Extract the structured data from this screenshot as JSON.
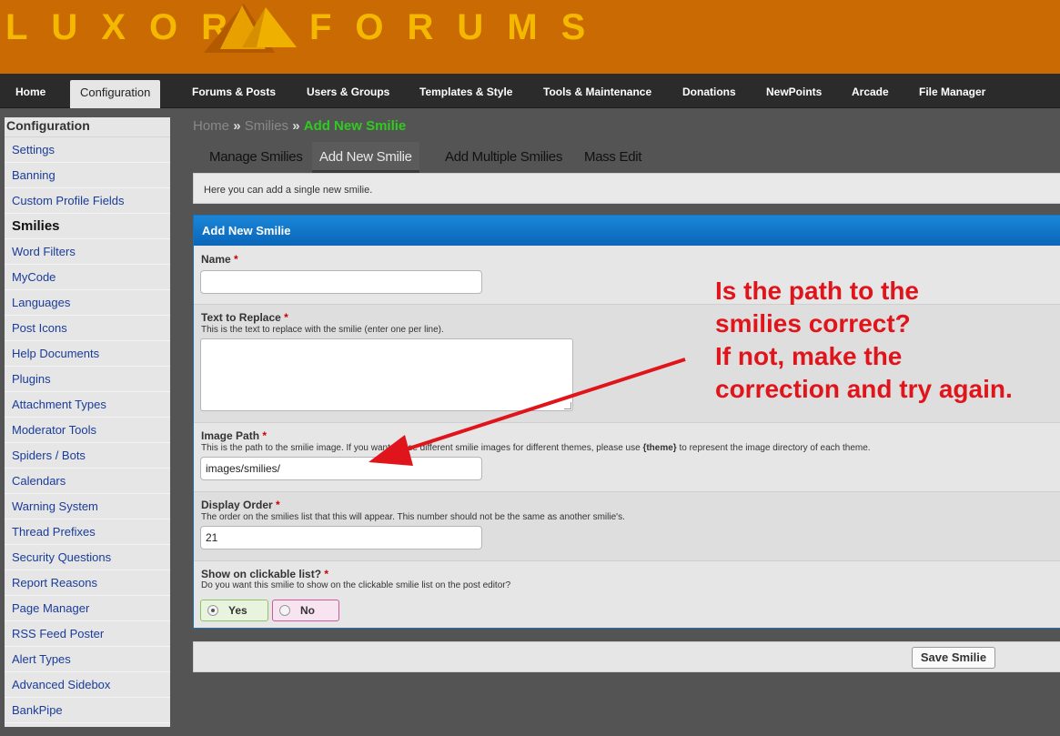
{
  "header": {
    "logo_left": "LUXOR",
    "logo_right": "FORUMS",
    "logo_icon": "pyramid-logo-icon"
  },
  "topnav": {
    "tabs": [
      {
        "label": "Home"
      },
      {
        "label": "Configuration",
        "active": true
      },
      {
        "label": "Forums & Posts"
      },
      {
        "label": "Users & Groups"
      },
      {
        "label": "Templates & Style"
      },
      {
        "label": "Tools & Maintenance"
      },
      {
        "label": "Donations"
      },
      {
        "label": "NewPoints"
      },
      {
        "label": "Arcade"
      },
      {
        "label": "File Manager"
      }
    ]
  },
  "sidebar": {
    "title": "Configuration",
    "items": [
      {
        "label": "Settings"
      },
      {
        "label": "Banning"
      },
      {
        "label": "Custom Profile Fields"
      },
      {
        "label": "Smilies",
        "active": true
      },
      {
        "label": "Word Filters"
      },
      {
        "label": "MyCode"
      },
      {
        "label": "Languages"
      },
      {
        "label": "Post Icons"
      },
      {
        "label": "Help Documents"
      },
      {
        "label": "Plugins"
      },
      {
        "label": "Attachment Types"
      },
      {
        "label": "Moderator Tools"
      },
      {
        "label": "Spiders / Bots"
      },
      {
        "label": "Calendars"
      },
      {
        "label": "Warning System"
      },
      {
        "label": "Thread Prefixes"
      },
      {
        "label": "Security Questions"
      },
      {
        "label": "Report Reasons"
      },
      {
        "label": "Page Manager"
      },
      {
        "label": "RSS Feed Poster"
      },
      {
        "label": "Alert Types"
      },
      {
        "label": "Advanced Sidebox"
      },
      {
        "label": "BankPipe"
      }
    ]
  },
  "breadcrumb": {
    "items": [
      "Home",
      "Smilies",
      "Add New Smilie"
    ],
    "separator": "»"
  },
  "subtabs": [
    {
      "label": "Manage Smilies"
    },
    {
      "label": "Add New Smilie",
      "active": true
    },
    {
      "label": "Add Multiple Smilies"
    },
    {
      "label": "Mass Edit"
    }
  ],
  "intro": "Here you can add a single new smilie.",
  "form": {
    "title": "Add New Smilie",
    "required_mark": "*",
    "name": {
      "label": "Name",
      "value": ""
    },
    "text_to_replace": {
      "label": "Text to Replace",
      "description": "This is the text to replace with the smilie (enter one per line).",
      "value": ""
    },
    "image_path": {
      "label": "Image Path",
      "description_start": "This is the path to the smilie image. If you want to use different smilie images for different themes, please use ",
      "description_bold": "{theme}",
      "description_end": " to represent the image directory of each theme.",
      "value": "images/smilies/"
    },
    "display_order": {
      "label": "Display Order",
      "description": "The order on the smilies list that this will appear. This number should not be the same as another smilie's.",
      "value": "21"
    },
    "show_clickable": {
      "label": "Show on clickable list?",
      "description": "Do you want this smilie to show on the clickable smilie list on the post editor?",
      "options": [
        {
          "label": "Yes",
          "checked": true
        },
        {
          "label": "No",
          "checked": false
        }
      ]
    },
    "save_label": "Save Smilie"
  },
  "annotation": {
    "lines": [
      "Is the path to the",
      "smilies correct?",
      "If not, make the",
      "correction and try again."
    ],
    "color": "#e0151b"
  },
  "colors": {
    "header_bg": "#c96a02",
    "logo_text": "#f5b800",
    "nav_bg": "#2b2b2b",
    "panel_head": "#0a66b9",
    "breadcrumb_current": "#2ecc1f"
  }
}
